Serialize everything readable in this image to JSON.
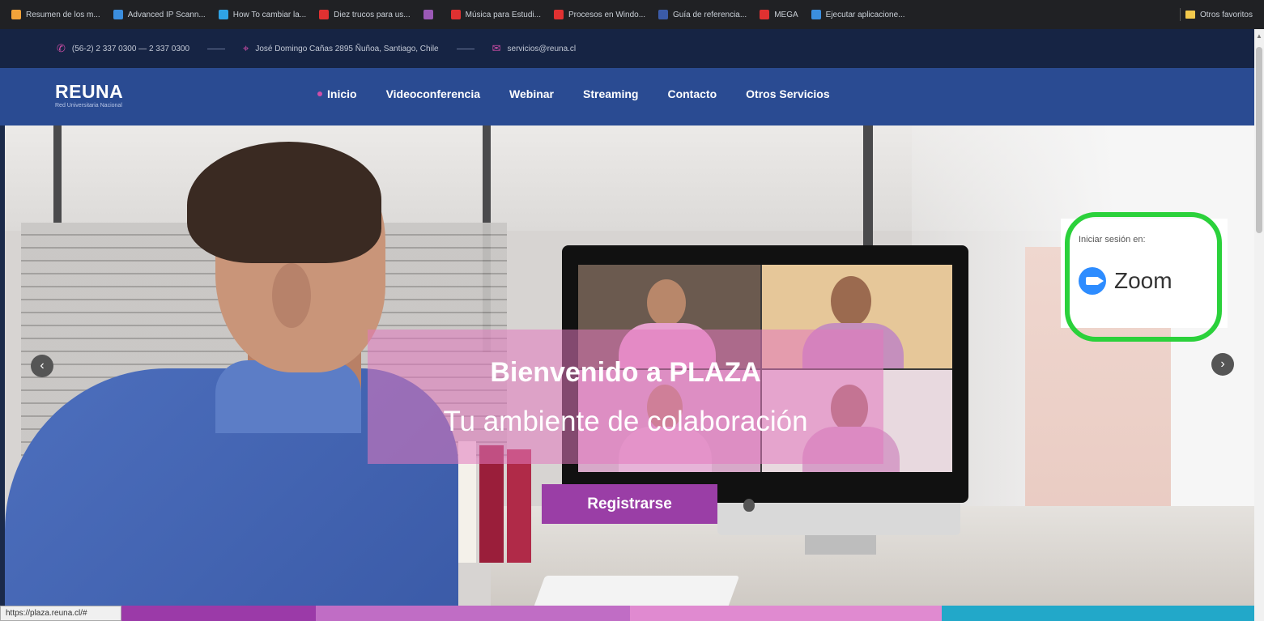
{
  "bookmarks": [
    {
      "label": "Resumen de los m...",
      "color": "#f2a33a"
    },
    {
      "label": "Advanced IP Scann...",
      "color": "#3b8ede"
    },
    {
      "label": "How To cambiar la...",
      "color": "#2fa3e6"
    },
    {
      "label": "Diez trucos para us...",
      "color": "#e03131"
    },
    {
      "label": "",
      "color": "#9b59b6"
    },
    {
      "label": "Música para Estudi...",
      "color": "#e03131"
    },
    {
      "label": "Procesos en Windo...",
      "color": "#e03131"
    },
    {
      "label": "Guía de referencia...",
      "color": "#3b5ba8"
    },
    {
      "label": "MEGA",
      "color": "#e03131"
    },
    {
      "label": "Ejecutar aplicacione...",
      "color": "#3b8ede"
    }
  ],
  "other_bookmarks_label": "Otros favoritos",
  "contact": {
    "phone": "(56-2) 2 337 0300 — 2 337 0300",
    "address": "José Domingo Cañas 2895 Ñuñoa, Santiago, Chile",
    "email": "servicios@reuna.cl"
  },
  "logo": {
    "main": "REUNA",
    "sub": "Red Universitaria Nacional"
  },
  "nav": {
    "items": [
      {
        "label": "Inicio",
        "active": true
      },
      {
        "label": "Videoconferencia"
      },
      {
        "label": "Webinar"
      },
      {
        "label": "Streaming"
      },
      {
        "label": "Contacto"
      },
      {
        "label": "Otros Servicios"
      }
    ]
  },
  "hero": {
    "headline": "Bienvenido a PLAZA",
    "subline": "Tu ambiente de colaboración",
    "register_label": "Registrarse",
    "prev_arrow": "‹",
    "next_arrow": "›"
  },
  "login": {
    "label": "Iniciar sesión en:",
    "service": "Zoom"
  },
  "status_url": "https://plaza.reuna.cl/#",
  "colors": {
    "purple": "#9b3aa8",
    "pink": "#e08ad0",
    "cyan": "#22a8c9",
    "nav": "#2a4b92",
    "ring": "#2bd13b"
  }
}
